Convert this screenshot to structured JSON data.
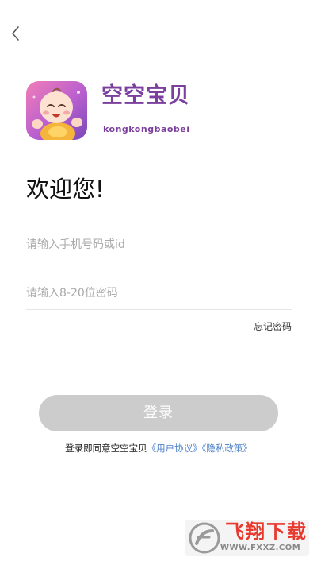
{
  "nav": {
    "back_icon": "chevron-left-icon"
  },
  "brand": {
    "title": "空空宝贝",
    "subtitle": "kongkongbaobei",
    "color": "#7b3f9e"
  },
  "welcome": "欢迎您!",
  "form": {
    "phone_placeholder": "请输入手机号码或id",
    "phone_value": "",
    "password_placeholder": "请输入8-20位密码",
    "password_value": "",
    "forgot_label": "忘记密码"
  },
  "login_button": {
    "label": "登录",
    "state": "disabled",
    "color": "#cccccc"
  },
  "agreement": {
    "prefix": "登录即同意空空宝贝",
    "user_agreement": "《用户协议》",
    "privacy_policy": "《隐私政策》",
    "link_color": "#4a7fc9"
  },
  "watermark": {
    "title": "飞翔下载",
    "url": "WWW.FXXZ.COM"
  }
}
